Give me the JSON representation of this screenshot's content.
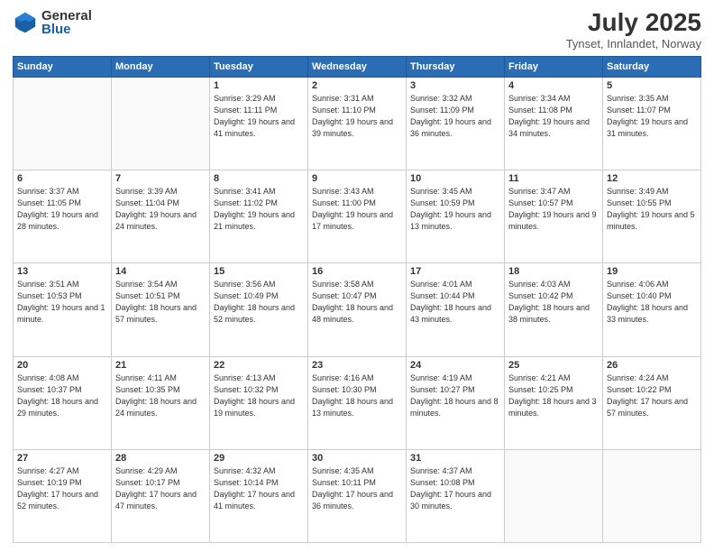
{
  "header": {
    "logo_general": "General",
    "logo_blue": "Blue",
    "month_title": "July 2025",
    "location": "Tynset, Innlandet, Norway"
  },
  "days_of_week": [
    "Sunday",
    "Monday",
    "Tuesday",
    "Wednesday",
    "Thursday",
    "Friday",
    "Saturday"
  ],
  "weeks": [
    [
      {
        "day": "",
        "info": ""
      },
      {
        "day": "",
        "info": ""
      },
      {
        "day": "1",
        "info": "Sunrise: 3:29 AM\nSunset: 11:11 PM\nDaylight: 19 hours\nand 41 minutes."
      },
      {
        "day": "2",
        "info": "Sunrise: 3:31 AM\nSunset: 11:10 PM\nDaylight: 19 hours\nand 39 minutes."
      },
      {
        "day": "3",
        "info": "Sunrise: 3:32 AM\nSunset: 11:09 PM\nDaylight: 19 hours\nand 36 minutes."
      },
      {
        "day": "4",
        "info": "Sunrise: 3:34 AM\nSunset: 11:08 PM\nDaylight: 19 hours\nand 34 minutes."
      },
      {
        "day": "5",
        "info": "Sunrise: 3:35 AM\nSunset: 11:07 PM\nDaylight: 19 hours\nand 31 minutes."
      }
    ],
    [
      {
        "day": "6",
        "info": "Sunrise: 3:37 AM\nSunset: 11:05 PM\nDaylight: 19 hours\nand 28 minutes."
      },
      {
        "day": "7",
        "info": "Sunrise: 3:39 AM\nSunset: 11:04 PM\nDaylight: 19 hours\nand 24 minutes."
      },
      {
        "day": "8",
        "info": "Sunrise: 3:41 AM\nSunset: 11:02 PM\nDaylight: 19 hours\nand 21 minutes."
      },
      {
        "day": "9",
        "info": "Sunrise: 3:43 AM\nSunset: 11:00 PM\nDaylight: 19 hours\nand 17 minutes."
      },
      {
        "day": "10",
        "info": "Sunrise: 3:45 AM\nSunset: 10:59 PM\nDaylight: 19 hours\nand 13 minutes."
      },
      {
        "day": "11",
        "info": "Sunrise: 3:47 AM\nSunset: 10:57 PM\nDaylight: 19 hours\nand 9 minutes."
      },
      {
        "day": "12",
        "info": "Sunrise: 3:49 AM\nSunset: 10:55 PM\nDaylight: 19 hours\nand 5 minutes."
      }
    ],
    [
      {
        "day": "13",
        "info": "Sunrise: 3:51 AM\nSunset: 10:53 PM\nDaylight: 19 hours\nand 1 minute."
      },
      {
        "day": "14",
        "info": "Sunrise: 3:54 AM\nSunset: 10:51 PM\nDaylight: 18 hours\nand 57 minutes."
      },
      {
        "day": "15",
        "info": "Sunrise: 3:56 AM\nSunset: 10:49 PM\nDaylight: 18 hours\nand 52 minutes."
      },
      {
        "day": "16",
        "info": "Sunrise: 3:58 AM\nSunset: 10:47 PM\nDaylight: 18 hours\nand 48 minutes."
      },
      {
        "day": "17",
        "info": "Sunrise: 4:01 AM\nSunset: 10:44 PM\nDaylight: 18 hours\nand 43 minutes."
      },
      {
        "day": "18",
        "info": "Sunrise: 4:03 AM\nSunset: 10:42 PM\nDaylight: 18 hours\nand 38 minutes."
      },
      {
        "day": "19",
        "info": "Sunrise: 4:06 AM\nSunset: 10:40 PM\nDaylight: 18 hours\nand 33 minutes."
      }
    ],
    [
      {
        "day": "20",
        "info": "Sunrise: 4:08 AM\nSunset: 10:37 PM\nDaylight: 18 hours\nand 29 minutes."
      },
      {
        "day": "21",
        "info": "Sunrise: 4:11 AM\nSunset: 10:35 PM\nDaylight: 18 hours\nand 24 minutes."
      },
      {
        "day": "22",
        "info": "Sunrise: 4:13 AM\nSunset: 10:32 PM\nDaylight: 18 hours\nand 19 minutes."
      },
      {
        "day": "23",
        "info": "Sunrise: 4:16 AM\nSunset: 10:30 PM\nDaylight: 18 hours\nand 13 minutes."
      },
      {
        "day": "24",
        "info": "Sunrise: 4:19 AM\nSunset: 10:27 PM\nDaylight: 18 hours\nand 8 minutes."
      },
      {
        "day": "25",
        "info": "Sunrise: 4:21 AM\nSunset: 10:25 PM\nDaylight: 18 hours\nand 3 minutes."
      },
      {
        "day": "26",
        "info": "Sunrise: 4:24 AM\nSunset: 10:22 PM\nDaylight: 17 hours\nand 57 minutes."
      }
    ],
    [
      {
        "day": "27",
        "info": "Sunrise: 4:27 AM\nSunset: 10:19 PM\nDaylight: 17 hours\nand 52 minutes."
      },
      {
        "day": "28",
        "info": "Sunrise: 4:29 AM\nSunset: 10:17 PM\nDaylight: 17 hours\nand 47 minutes."
      },
      {
        "day": "29",
        "info": "Sunrise: 4:32 AM\nSunset: 10:14 PM\nDaylight: 17 hours\nand 41 minutes."
      },
      {
        "day": "30",
        "info": "Sunrise: 4:35 AM\nSunset: 10:11 PM\nDaylight: 17 hours\nand 36 minutes."
      },
      {
        "day": "31",
        "info": "Sunrise: 4:37 AM\nSunset: 10:08 PM\nDaylight: 17 hours\nand 30 minutes."
      },
      {
        "day": "",
        "info": ""
      },
      {
        "day": "",
        "info": ""
      }
    ]
  ]
}
